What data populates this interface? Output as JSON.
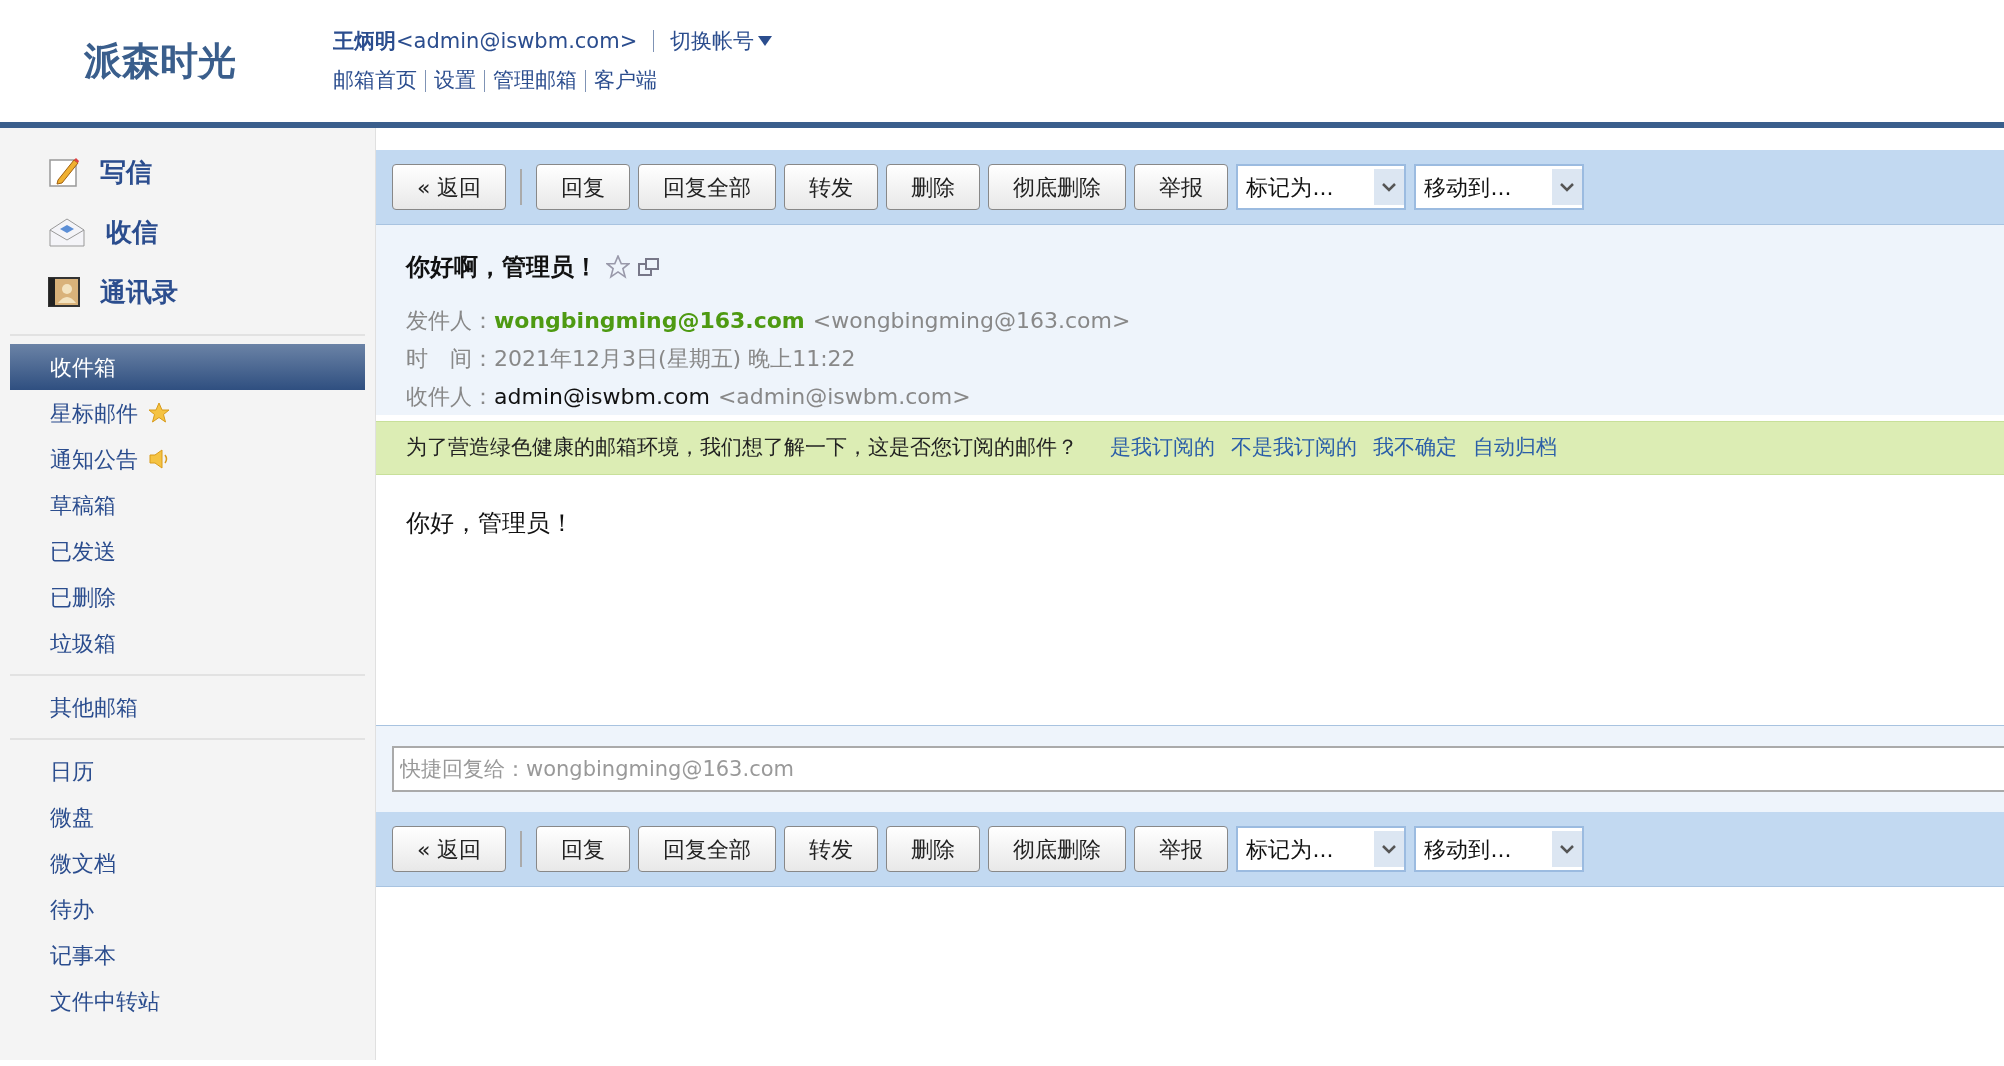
{
  "header": {
    "logo": "派森时光",
    "user_name": "王炳明",
    "user_email": "<admin@iswbm.com>",
    "switch_account": "切换帐号",
    "links": [
      "邮箱首页",
      "设置",
      "管理邮箱",
      "客户端"
    ]
  },
  "sidebar": {
    "actions": [
      {
        "label": "写信",
        "kind": "compose"
      },
      {
        "label": "收信",
        "kind": "receive"
      },
      {
        "label": "通讯录",
        "kind": "contacts"
      }
    ],
    "folders": [
      {
        "label": "收件箱",
        "selected": true
      },
      {
        "label": "星标邮件",
        "selected": false,
        "kind": "star"
      },
      {
        "label": "通知公告",
        "selected": false,
        "kind": "speaker"
      },
      {
        "label": "草稿箱",
        "selected": false
      },
      {
        "label": "已发送",
        "selected": false
      },
      {
        "label": "已删除",
        "selected": false
      },
      {
        "label": "垃圾箱",
        "selected": false
      }
    ],
    "other": [
      {
        "label": "其他邮箱",
        "selected": false
      }
    ],
    "apps": [
      {
        "label": "日历",
        "selected": false
      },
      {
        "label": "微盘",
        "selected": false
      },
      {
        "label": "微文档",
        "selected": false
      },
      {
        "label": "待办",
        "selected": false
      },
      {
        "label": "记事本",
        "selected": false
      },
      {
        "label": "文件中转站",
        "selected": false
      }
    ]
  },
  "toolbar_top": {
    "back": "« 返回",
    "buttons": [
      "回复",
      "回复全部",
      "转发",
      "删除",
      "彻底删除",
      "举报"
    ],
    "dropdowns": [
      "标记为...",
      "移动到..."
    ]
  },
  "message": {
    "subject": "你好啊，管理员！",
    "starred": false,
    "meta": [
      {
        "kind": "sender",
        "label": "发件人：",
        "name": "wongbingming@163.com",
        "address": "<wongbingming@163.com>"
      },
      {
        "kind": "time",
        "label": "时　间：",
        "value": "2021年12月3日(星期五) 晚上11:22"
      },
      {
        "kind": "recipient",
        "label": "收件人：",
        "name": "admin@iswbm.com",
        "address": "<admin@iswbm.com>"
      }
    ],
    "notice": {
      "text": "为了营造绿色健康的邮箱环境，我们想了解一下，这是否您订阅的邮件？",
      "links": [
        "是我订阅的",
        "不是我订阅的",
        "我不确定",
        "自动归档"
      ]
    },
    "body": "你好，管理员！"
  },
  "quick_reply": {
    "placeholder": "快捷回复给：wongbingming@163.com"
  },
  "toolbar_bottom": {
    "back": "« 返回",
    "buttons": [
      "回复",
      "回复全部",
      "转发",
      "删除",
      "彻底删除",
      "举报"
    ],
    "dropdowns": [
      "标记为...",
      "移动到..."
    ]
  }
}
